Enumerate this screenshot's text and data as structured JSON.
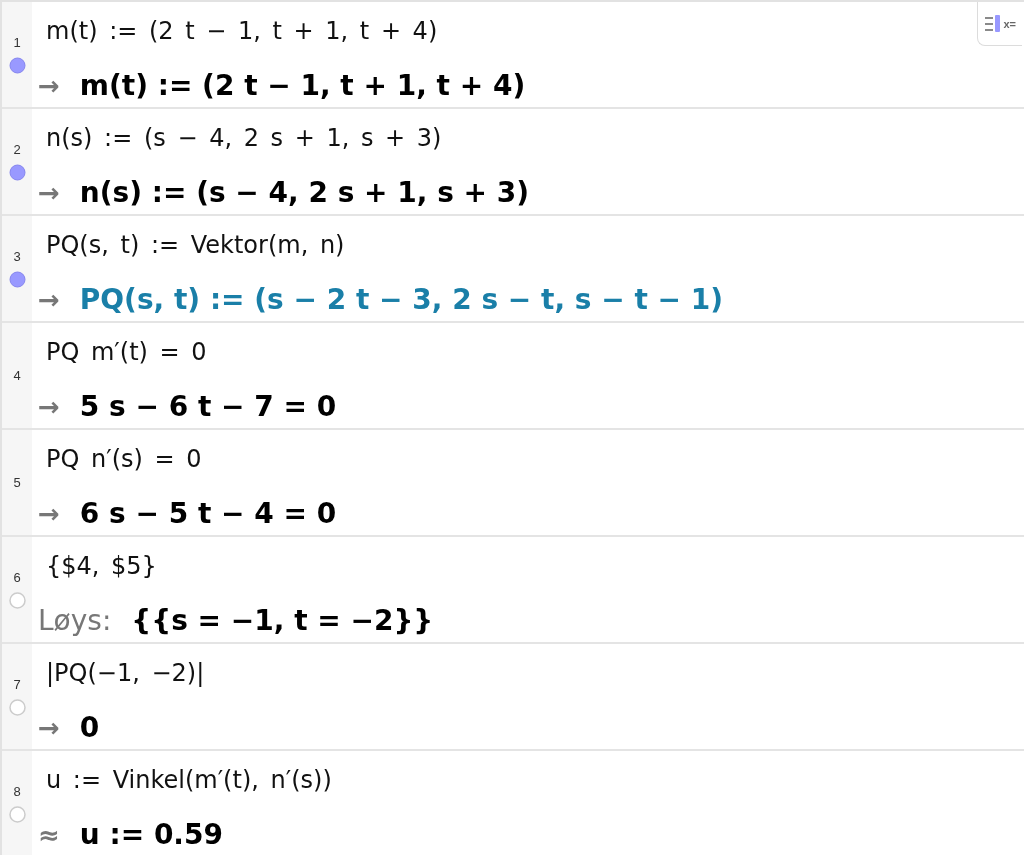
{
  "view_toggle": {
    "label": "x="
  },
  "rows": [
    {
      "number": "1",
      "input": "m(t) := (2 t − 1, t + 1, t + 4)",
      "marker": {
        "on": true
      },
      "output": {
        "kind": "symbol",
        "prefix": "→",
        "text": "m(t) := (2 t − 1, t + 1, t + 4)",
        "color": "#000000"
      }
    },
    {
      "number": "2",
      "input": "n(s) := (s − 4, 2 s + 1, s + 3)",
      "marker": {
        "on": true
      },
      "output": {
        "kind": "symbol",
        "prefix": "→",
        "text": "n(s) := (s − 4, 2 s + 1, s + 3)",
        "color": "#000000"
      }
    },
    {
      "number": "3",
      "input": "PQ(s, t) := Vektor(m, n)",
      "marker": {
        "on": true
      },
      "output": {
        "kind": "symbol",
        "prefix": "→",
        "text": "PQ(s, t) := (s − 2 t − 3, 2 s − t, s − t − 1)",
        "color": "#1a7fa8"
      }
    },
    {
      "number": "4",
      "input": "PQ m′(t) = 0",
      "output": {
        "kind": "symbol",
        "prefix": "→",
        "text": "5 s − 6 t − 7 = 0",
        "color": "#000000"
      }
    },
    {
      "number": "5",
      "input": "PQ n′(s) = 0",
      "output": {
        "kind": "symbol",
        "prefix": "→",
        "text": "6 s − 5 t − 4 = 0",
        "color": "#000000"
      }
    },
    {
      "number": "6",
      "input": "{$4, $5}",
      "marker": {
        "on": false
      },
      "output": {
        "kind": "label",
        "prefix": "Løys:",
        "text": "{{s = −1, t = −2}}",
        "color": "#000000"
      }
    },
    {
      "number": "7",
      "input": "|PQ(−1, −2)|",
      "marker": {
        "on": false
      },
      "output": {
        "kind": "symbol",
        "prefix": "→",
        "text": "0",
        "color": "#000000"
      }
    },
    {
      "number": "8",
      "input": "u := Vinkel(m′(t), n′(s))",
      "marker": {
        "on": false
      },
      "output": {
        "kind": "symbol",
        "prefix": "≈",
        "text": "u := 0.59",
        "color": "#000000"
      }
    }
  ]
}
